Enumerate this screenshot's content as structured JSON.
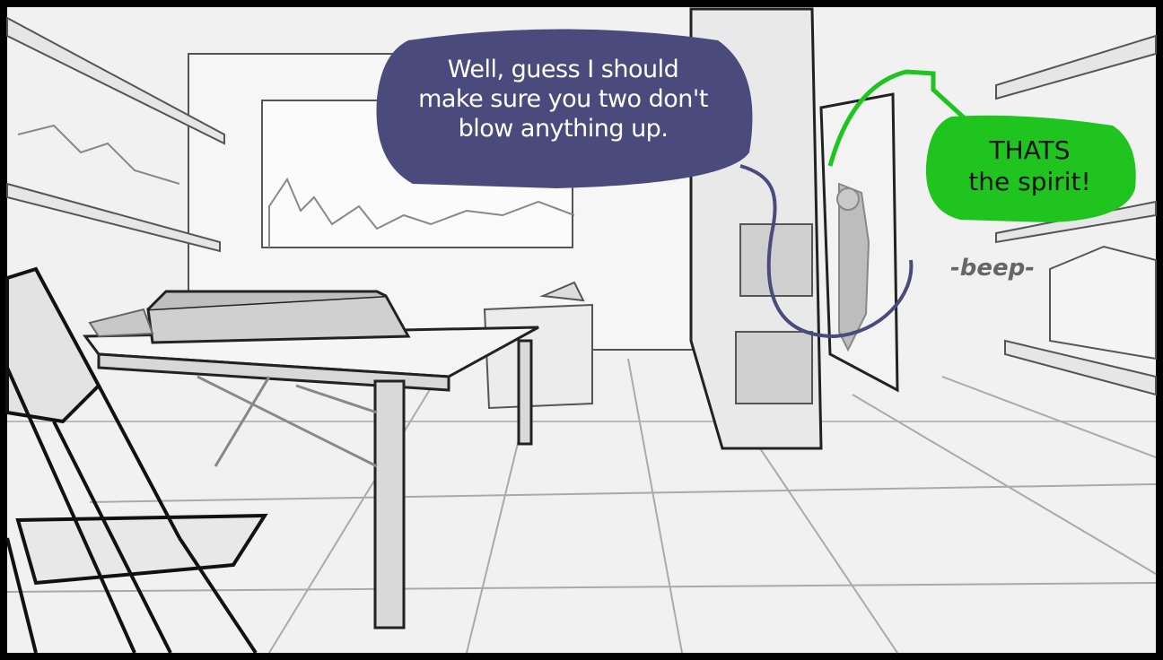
{
  "speech_bubbles": [
    {
      "speaker": "offscreen",
      "lines": [
        "Well, guess I should",
        "make sure you two don't",
        "blow anything up."
      ],
      "color": "#4a4a7c",
      "text_color": "#ffffff"
    },
    {
      "speaker": "figure in doorway",
      "lines": [
        "THATS",
        "the spirit!"
      ],
      "color": "#1fc41f",
      "text_color": "#111111"
    }
  ],
  "sound_effect": {
    "text": "-beep-",
    "color": "#666666"
  },
  "scene": {
    "palette": {
      "background": "#efefef",
      "line": "#3a3a3a",
      "shade": "#cfcfcf",
      "frame": "#000000"
    }
  }
}
